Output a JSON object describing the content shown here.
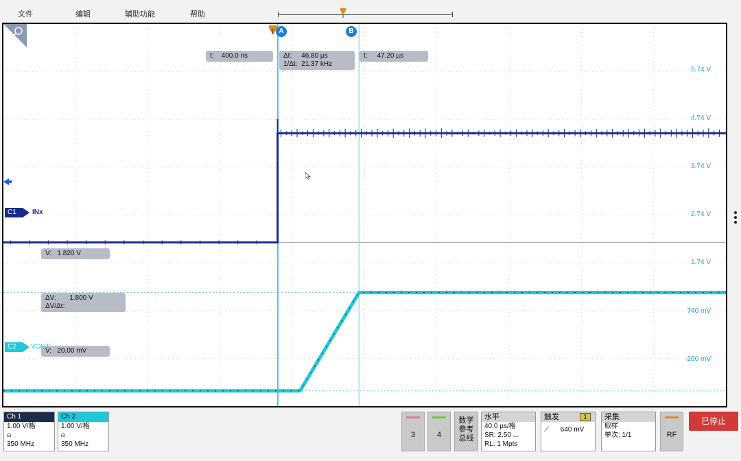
{
  "menu": [
    "文件",
    "编辑",
    "辅助功能",
    "帮助"
  ],
  "colors": {
    "ch1": "#1a2a8a",
    "ch2": "#1ec8d8",
    "cursor": "#6fc8e8",
    "grid": "#cfcfcf",
    "voltage_label": "#1fa0c8",
    "stop": "#d23a3a"
  },
  "cursors": {
    "a_label": "A",
    "b_label": "B",
    "t_a": "t:    400.0 ns",
    "delta_t": "Δt:     46.80 µs",
    "inv_delta_t": "1/Δt:  21.37 kHz",
    "t_b": "t:     47.20 µs",
    "v_a": "V:   1.820 V",
    "delta_v": "ΔV:       1.800 V",
    "delta_v_dt": "ΔV/Δt:",
    "v_b": "V:   20.00 mV"
  },
  "axis_labels": [
    "5.74 V",
    "4.74 V",
    "3.74 V",
    "2.74 V",
    "1.74 V",
    "740 mV",
    "-260 mV"
  ],
  "channel_tags": {
    "c1_tag": "C1",
    "c1_name": "INx",
    "c2_tag": "C2",
    "c2_name": "VOUT"
  },
  "chart_data": {
    "type": "line",
    "series": [
      {
        "name": "INx",
        "x_us": [
          -159,
          0,
          0,
          260
        ],
        "y_v": [
          2.74,
          2.74,
          4.74,
          4.74
        ]
      },
      {
        "name": "VOUT",
        "x_us": [
          -159,
          13,
          47.2,
          260
        ],
        "y_v": [
          0.02,
          0.02,
          1.82,
          1.82
        ]
      }
    ],
    "ylim_v": [
      -0.26,
      6.74
    ],
    "grid": true
  },
  "bottom": {
    "ch1": {
      "title": "Ch 1",
      "scale": "1.00 V/格",
      "bw": "350 MHz"
    },
    "ch2": {
      "title": "Ch 2",
      "scale": "1.00 V/格",
      "bw": "350 MHz"
    },
    "btn3": "3",
    "btn4": "4",
    "math": [
      "数学",
      "参考",
      "总线"
    ],
    "horizontal": {
      "title": "水平",
      "scale": "40.0 µs/格",
      "sr": "SR: 2.50 ...",
      "rl": "RL: 1 Mpts"
    },
    "trigger": {
      "title": "触发",
      "channel": "1",
      "level": "640 mV"
    },
    "acquire": {
      "title": "采集",
      "mode": "取样",
      "single": "单次: 1/1"
    },
    "rf": "RF",
    "stop": "已停止"
  }
}
